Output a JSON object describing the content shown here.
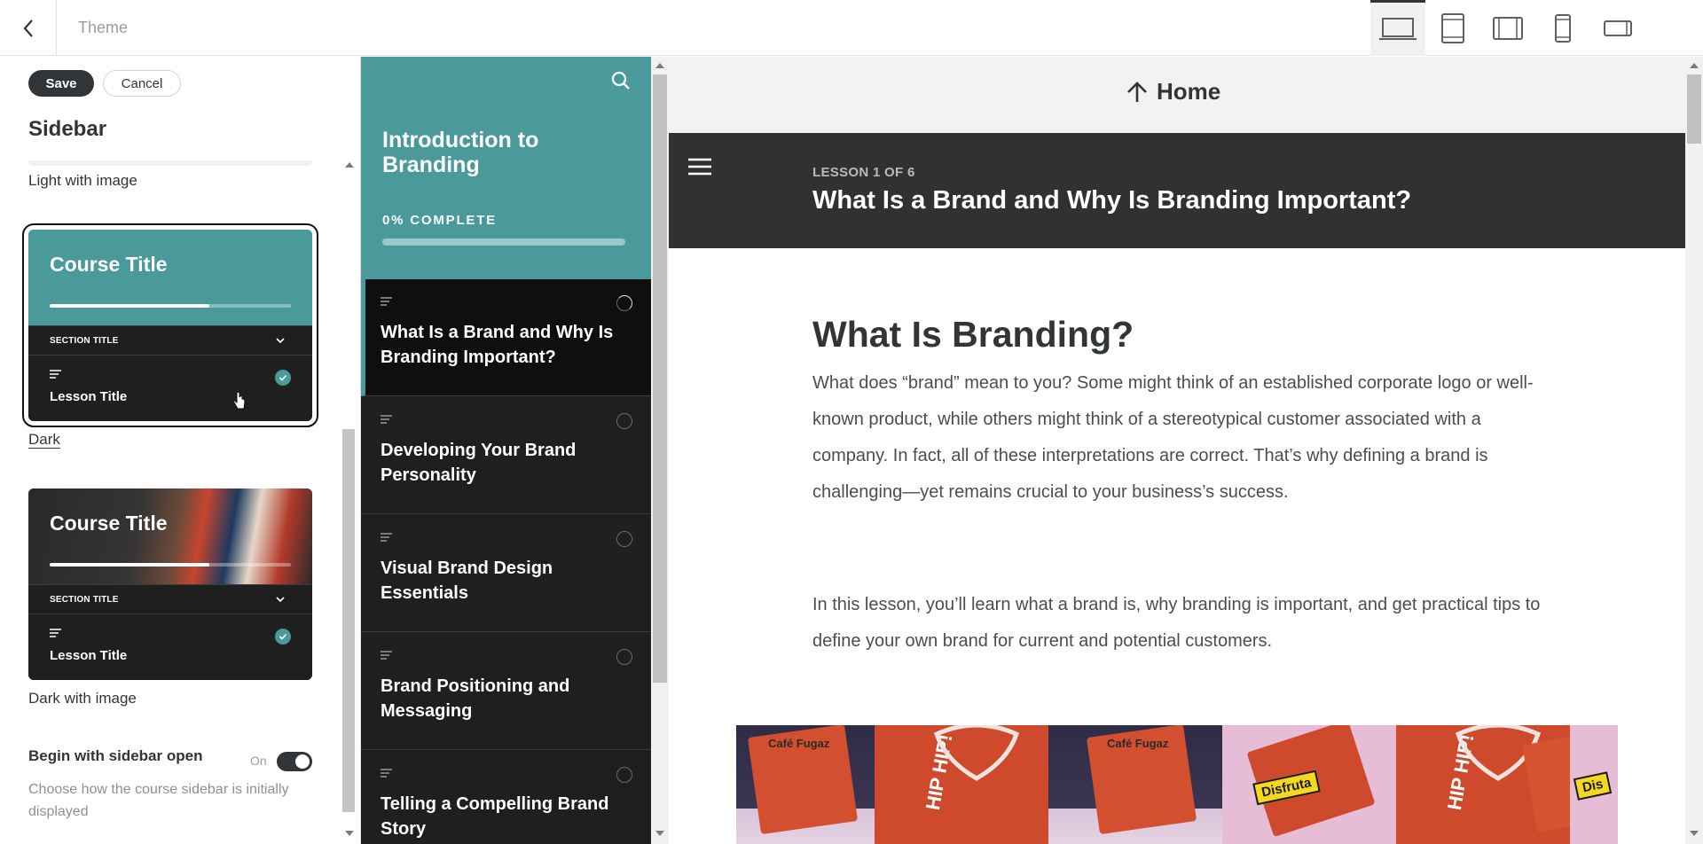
{
  "topbar": {
    "title": "Theme",
    "devices": [
      {
        "name": "desktop",
        "active": true
      },
      {
        "name": "tablet-portrait",
        "active": false
      },
      {
        "name": "tablet-landscape",
        "active": false
      },
      {
        "name": "phone-portrait",
        "active": false
      },
      {
        "name": "phone-landscape",
        "active": false
      }
    ]
  },
  "settings": {
    "save_label": "Save",
    "cancel_label": "Cancel",
    "heading": "Sidebar",
    "options": [
      {
        "label": "Light with image"
      },
      {
        "label": "Dark",
        "selected": true
      },
      {
        "label": "Dark with image"
      }
    ],
    "preview_card": {
      "course_title": "Course Title",
      "section_title": "SECTION TITLE",
      "lesson_title": "Lesson Title"
    },
    "begin_open": {
      "title": "Begin with sidebar open",
      "state": "On",
      "description": "Choose how the course sidebar is initially displayed"
    }
  },
  "course_sidebar": {
    "title": "Introduction to Branding",
    "progress_label": "0% COMPLETE",
    "progress": 0,
    "lessons": [
      {
        "title": "What Is a Brand and Why Is Branding Important?",
        "active": true
      },
      {
        "title": "Developing Your Brand Personality"
      },
      {
        "title": "Visual Brand Design Essentials"
      },
      {
        "title": "Brand Positioning and Messaging"
      },
      {
        "title": "Telling a Compelling Brand Story"
      }
    ]
  },
  "main": {
    "home_label": "Home",
    "lesson_count": "LESSON 1 OF 6",
    "lesson_title": "What Is a Brand and Why Is Branding Important?",
    "heading": "What Is Branding?",
    "paragraphs": [
      "What does “brand” mean to you? Some might think of an established corporate logo or well-known product, while others might think of a stereotypical customer associated with a company. In fact, all of these interpretations are correct. That’s why defining a brand is challenging—yet remains crucial to your business’s success.",
      "In this lesson, you’ll learn what a brand is, why branding is important, and get practical tips to define your own brand for current and potential customers."
    ],
    "image_text": {
      "brand": "Café Fugaz",
      "hip": "HIP HIP!",
      "tag": "Disfruta",
      "tag_cut": "Dis"
    }
  },
  "colors": {
    "accent": "#4a9a9c",
    "dark": "#1f1f1f",
    "header": "#313131"
  }
}
